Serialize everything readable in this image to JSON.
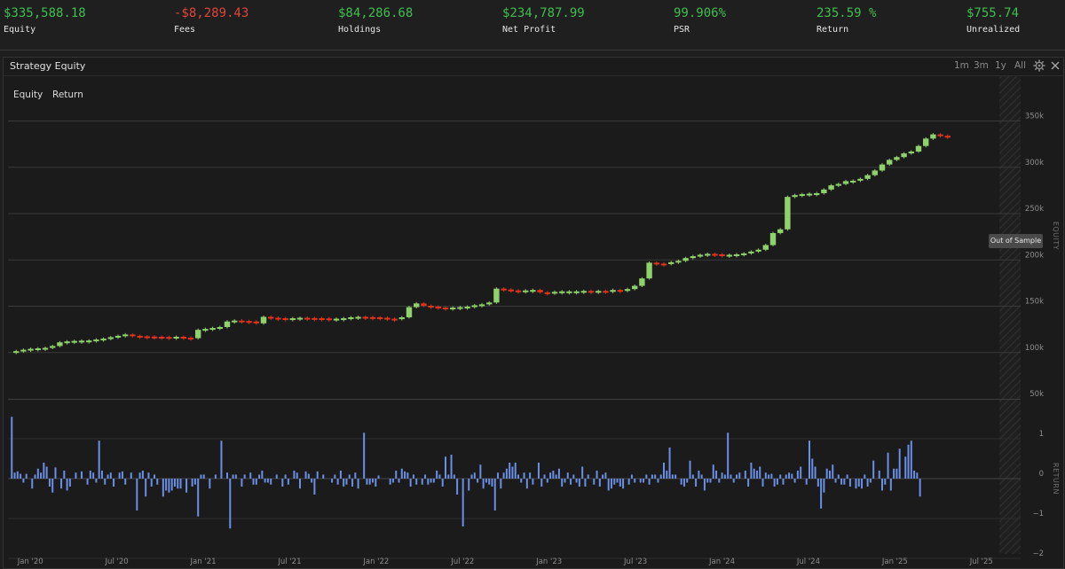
{
  "stats": [
    {
      "value": "$335,588.18",
      "label": "Equity",
      "color": "#3fbf4f"
    },
    {
      "value": "-$8,289.43",
      "label": "Fees",
      "color": "#e0463b"
    },
    {
      "value": "$84,286.68",
      "label": "Holdings",
      "color": "#3fbf4f"
    },
    {
      "value": "$234,787.99",
      "label": "Net Profit",
      "color": "#3fbf4f"
    },
    {
      "value": "99.906%",
      "label": "PSR",
      "color": "#3fbf4f"
    },
    {
      "value": "235.59 %",
      "label": "Return",
      "color": "#3fbf4f"
    },
    {
      "value": "$755.74",
      "label": "Unrealized",
      "color": "#3fbf4f"
    }
  ],
  "panel": {
    "title": "Strategy Equity",
    "ranges": [
      "1m",
      "3m",
      "1y",
      "All"
    ],
    "settings_icon": "gear-icon",
    "close_icon": "close-icon",
    "series_tabs": [
      "Equity",
      "Return"
    ],
    "out_of_sample_label": "Out of Sample"
  },
  "colors": {
    "up": "#8fd16c",
    "down": "#e2331f",
    "return_bars": "#6a8fe6",
    "grid": "#3a3a3a"
  },
  "chart_data": [
    {
      "type": "candlestick",
      "title": "Strategy Equity",
      "ylabel": "EQUITY",
      "ylim": [
        50000,
        350000
      ],
      "yticks": [
        50000,
        100000,
        150000,
        200000,
        250000,
        300000,
        350000
      ],
      "ytick_labels": [
        "50k",
        "100k",
        "150k",
        "200k",
        "250k",
        "300k",
        "350k"
      ],
      "xtick_labels": [
        "Jan '20",
        "Jul '20",
        "Jan '21",
        "Jul '21",
        "Jan '22",
        "Jul '22",
        "Jan '23",
        "Jul '23",
        "Jan '24",
        "Jul '24",
        "Jan '25",
        "Jul '25"
      ],
      "x": [
        0.0,
        0.5,
        1.0,
        1.5,
        2.0,
        2.5,
        3.0,
        3.5,
        4.0,
        4.5,
        5.0,
        5.5,
        6.0,
        6.5,
        7.0,
        7.5,
        8.0,
        8.5,
        9.0,
        9.5,
        10.0,
        10.5,
        11.0,
        11.5,
        12.0,
        12.5,
        13.0,
        13.5,
        14.0,
        14.5,
        15.0,
        15.5,
        16.0,
        16.5,
        17.0,
        17.5,
        18.0,
        18.5,
        19.0,
        19.5,
        20.0,
        20.5,
        21.0,
        21.5,
        22.0,
        22.5,
        23.0,
        23.5,
        24.0,
        24.5,
        25.0,
        25.5,
        26.0,
        26.5,
        27.0,
        27.5,
        28.0,
        28.5,
        29.0,
        29.5,
        30.0,
        30.5,
        31.0,
        31.5,
        32.0,
        32.5,
        33.0,
        33.5,
        34.0,
        34.5,
        35.0,
        35.5,
        36.0,
        36.5,
        37.0,
        37.5,
        38.0,
        38.5,
        39.0,
        39.5,
        40.0,
        40.5,
        41.0,
        41.5,
        42.0,
        42.5,
        43.0,
        43.5,
        44.0,
        44.5,
        45.0,
        45.5,
        46.0,
        46.5,
        47.0,
        47.5,
        48.0,
        48.5,
        49.0,
        49.5,
        50.0,
        50.5,
        51.0,
        51.5,
        52.0,
        52.5,
        53.0,
        53.5,
        54.0,
        54.5,
        55.0,
        55.5,
        56.0,
        56.5,
        57.0,
        57.5,
        58.0,
        58.5,
        59.0,
        59.5,
        60.0,
        60.5,
        61.0,
        61.5,
        62.0,
        62.5,
        63.0,
        63.5,
        64.0,
        64.5,
        65.0,
        65.5,
        66.0,
        66.5
      ],
      "values": [
        100000,
        101500,
        103000,
        104000,
        104500,
        105000,
        107000,
        111000,
        112000,
        112500,
        112800,
        113000,
        114000,
        115000,
        116500,
        118000,
        119500,
        118000,
        117500,
        117200,
        117000,
        116800,
        116500,
        117000,
        116000,
        115500,
        124500,
        125500,
        126500,
        127500,
        133500,
        134500,
        134000,
        133500,
        131500,
        138500,
        137500,
        137000,
        136500,
        137000,
        137500,
        137200,
        137000,
        136800,
        136500,
        136500,
        137000,
        138000,
        138500,
        138200,
        138000,
        137500,
        136500,
        136000,
        138000,
        149000,
        153000,
        150500,
        149500,
        148500,
        148000,
        148500,
        149000,
        149500,
        151000,
        152000,
        154000,
        169000,
        168000,
        167000,
        166500,
        167000,
        167500,
        165000,
        164500,
        165500,
        166000,
        166000,
        166000,
        166500,
        166000,
        166500,
        165500,
        167500,
        166500,
        168500,
        172000,
        180000,
        197000,
        196000,
        195500,
        197500,
        199000,
        202000,
        204000,
        205500,
        206500,
        206000,
        205000,
        205500,
        206000,
        207000,
        209000,
        211000,
        216000,
        229000,
        233000,
        268000,
        270000,
        271000,
        271500,
        272000,
        276000,
        280500,
        282000,
        285000,
        285500,
        287500,
        291500,
        296500,
        303000,
        308000,
        311000,
        315000,
        317000,
        323000,
        331000,
        335500,
        334000,
        333000
      ],
      "out_of_sample": true
    },
    {
      "type": "bar",
      "ylabel": "RETURN",
      "ylim": [
        -2,
        1.5
      ],
      "yticks": [
        -2,
        -1,
        0,
        1
      ],
      "ytick_labels": [
        "−2",
        "−1",
        "0",
        "1"
      ],
      "x": [
        0.2,
        0.4,
        0.6,
        0.8,
        1.0,
        1.2,
        1.6,
        1.8,
        2.0,
        2.2,
        2.4,
        2.6,
        2.8,
        3.0,
        3.2,
        3.6,
        3.8,
        4.0,
        4.2,
        4.6,
        5.0,
        5.4,
        5.6,
        5.8,
        6.0,
        6.2,
        6.4,
        6.6,
        6.8,
        7.0,
        7.2,
        7.6,
        7.8,
        8.0,
        8.4,
        8.8,
        9.0,
        9.2,
        9.4,
        9.6,
        9.8,
        10.0,
        10.2,
        10.6,
        10.8,
        11.0,
        11.2,
        11.4,
        11.6,
        11.8,
        12.2,
        12.6,
        12.8,
        13.0,
        13.2,
        13.4,
        13.8,
        14.2,
        14.6,
        15.0,
        15.2,
        15.4,
        15.6,
        16.0,
        16.2,
        16.6,
        16.8,
        17.0,
        17.2,
        17.4,
        17.6,
        17.8,
        18.0,
        18.4,
        18.8,
        19.0,
        19.2,
        19.6,
        19.8,
        20.0,
        20.4,
        20.6,
        20.8,
        21.0,
        21.2,
        21.6,
        22.2,
        22.4,
        22.6,
        22.8,
        23.0,
        23.2,
        23.4,
        23.6,
        23.8,
        24.0,
        24.4,
        24.6,
        24.8,
        25.0,
        25.2,
        25.4,
        26.2,
        26.4,
        26.6,
        26.8,
        27.0,
        27.2,
        27.4,
        27.6,
        27.8,
        28.0,
        28.4,
        28.6,
        28.8,
        29.0,
        29.2,
        29.4,
        29.6,
        29.8,
        30.0,
        30.2,
        30.4,
        30.6,
        30.8,
        31.2,
        31.6,
        31.8,
        32.0,
        32.2,
        32.4,
        32.6,
        32.8,
        33.0,
        33.2,
        33.4,
        33.6,
        33.8,
        34.0,
        34.2,
        34.4,
        34.6,
        34.8,
        35.0,
        35.2,
        35.4,
        35.6,
        35.8,
        36.0,
        36.4,
        36.6,
        36.8,
        37.0,
        37.2,
        37.4,
        37.6,
        37.8,
        38.0,
        38.2,
        38.4,
        38.6,
        38.8,
        39.0,
        39.2,
        39.4,
        39.6,
        39.8,
        40.2,
        40.4,
        40.6,
        40.8,
        41.0,
        41.2,
        41.4,
        41.6,
        41.8,
        42.0,
        42.2,
        42.6,
        42.8,
        43.0,
        43.4,
        43.6,
        43.8,
        44.0,
        44.2,
        44.4,
        44.6,
        44.8,
        45.0,
        45.2,
        45.4,
        45.6,
        45.8,
        46.2,
        46.4,
        46.6,
        46.8,
        47.0,
        47.2,
        47.4,
        47.6,
        47.8,
        48.0,
        48.2,
        48.4,
        48.6,
        48.8,
        49.0,
        49.2,
        49.4,
        49.6,
        49.8,
        50.0,
        50.2,
        50.6,
        50.8,
        51.0,
        51.2,
        51.4,
        51.6,
        51.8,
        52.0,
        52.2,
        52.4,
        52.6,
        52.8,
        53.0,
        53.2,
        53.4,
        53.6,
        53.8,
        54.0,
        54.2,
        54.4,
        54.8,
        55.0,
        55.2,
        55.4,
        55.6,
        55.8,
        56.0,
        56.2,
        56.4,
        56.6,
        56.8,
        57.0,
        57.2,
        57.4,
        57.6,
        57.8,
        58.2,
        58.4,
        58.6,
        58.8,
        59.0,
        59.2,
        59.4,
        59.8,
        60.0,
        60.2,
        60.4,
        60.6,
        60.8,
        61.0,
        61.2,
        61.6,
        61.8,
        62.0,
        62.2,
        62.4,
        62.6,
        62.8,
        63.0,
        63.2,
        63.4,
        63.6,
        63.8,
        64.0,
        64.2,
        64.4,
        64.6,
        65.0,
        65.4
      ],
      "values": [
        1.55,
        0.15,
        0.18,
        0.12,
        -0.1,
        0.12,
        -0.25,
        0.1,
        0.25,
        0.15,
        0.4,
        0.3,
        -0.2,
        -0.35,
        0.28,
        -0.25,
        0.2,
        -0.3,
        -0.2,
        0.15,
        0.18,
        -0.15,
        0.2,
        0.15,
        -0.1,
        0.95,
        0.2,
        -0.15,
        0.1,
        0.15,
        -0.2,
        0.15,
        0.18,
        -0.15,
        0.15,
        -0.8,
        0.15,
        0.2,
        -0.45,
        0.15,
        -0.2,
        0.1,
        -0.15,
        -0.45,
        -0.3,
        -0.35,
        -0.3,
        -0.2,
        -0.25,
        -0.25,
        -0.35,
        -0.2,
        -0.15,
        -0.95,
        0.1,
        0.1,
        -0.25,
        0.1,
        0.95,
        0.15,
        -1.25,
        0.1,
        0.1,
        -0.2,
        0.1,
        0.15,
        -0.15,
        -0.15,
        0.1,
        0.2,
        -0.1,
        -0.1,
        -0.15,
        0.1,
        -0.2,
        0.1,
        -0.15,
        0.2,
        0.15,
        -0.25,
        0.18,
        0.12,
        -0.1,
        -0.4,
        0.18,
        0.1,
        -0.1,
        0.1,
        -0.15,
        0.2,
        -0.2,
        -0.15,
        0.1,
        -0.2,
        0.15,
        -0.25,
        1.15,
        -0.15,
        -0.15,
        -0.1,
        -0.2,
        0.08,
        -0.15,
        -0.1,
        0.2,
        -0.1,
        0.25,
        0.18,
        0.15,
        -0.2,
        0.1,
        -0.15,
        -0.15,
        0.1,
        -0.15,
        -0.1,
        -0.1,
        0.2,
        0.1,
        -0.2,
        0.55,
        0.1,
        0.6,
        0.1,
        -0.4,
        -1.2,
        -0.3,
        0.1,
        0.15,
        -0.1,
        0.35,
        -0.25,
        -0.1,
        -0.15,
        -0.2,
        -0.8,
        0.15,
        -0.25,
        0.15,
        0.25,
        0.4,
        0.3,
        0.4,
        0.1,
        -0.1,
        0.15,
        -0.25,
        0.15,
        -0.15,
        0.4,
        -0.2,
        0.1,
        -0.1,
        0.15,
        0.2,
        0.1,
        0.25,
        -0.2,
        -0.1,
        0.15,
        -0.15,
        0.1,
        -0.1,
        -0.2,
        0.3,
        -0.2,
        0.1,
        -0.15,
        0.2,
        -0.2,
        0.1,
        0.15,
        -0.3,
        -0.25,
        -0.15,
        -0.1,
        -0.2,
        -0.25,
        -0.15,
        0.1,
        -0.1,
        -0.1,
        -0.1,
        0.1,
        -0.15,
        0.1,
        0.1,
        -0.1,
        0.1,
        0.4,
        0.2,
        0.78,
        0.1,
        0.1,
        -0.15,
        -0.2,
        -0.1,
        0.45,
        0.1,
        -0.2,
        0.2,
        0.1,
        -0.3,
        -0.1,
        -0.1,
        0.35,
        0.2,
        -0.1,
        0.15,
        0.1,
        1.15,
        0.1,
        -0.1,
        0.1,
        0.15,
        0.2,
        -0.2,
        0.4,
        0.25,
        0.2,
        0.3,
        -0.2,
        0.15,
        0.1,
        0.12,
        -0.2,
        -0.15,
        0.1,
        -0.15,
        0.1,
        0.15,
        0.12,
        -0.1,
        0.2,
        0.3,
        -0.15,
        0.95,
        0.5,
        0.3,
        -0.2,
        -0.75,
        -0.35,
        0.25,
        0.2,
        0.35,
        -0.1,
        0.1,
        -0.15,
        -0.15,
        0.1,
        -0.2,
        -0.25,
        -0.2,
        -0.25,
        0.1,
        -0.2,
        -0.1,
        0.45,
        0.2,
        -0.3,
        -0.15,
        0.65,
        -0.3,
        0.25,
        0.25,
        0.75,
        0.55,
        0.85,
        0.95,
        0.2,
        0.15,
        -0.45
      ],
      "out_of_sample": true
    }
  ]
}
